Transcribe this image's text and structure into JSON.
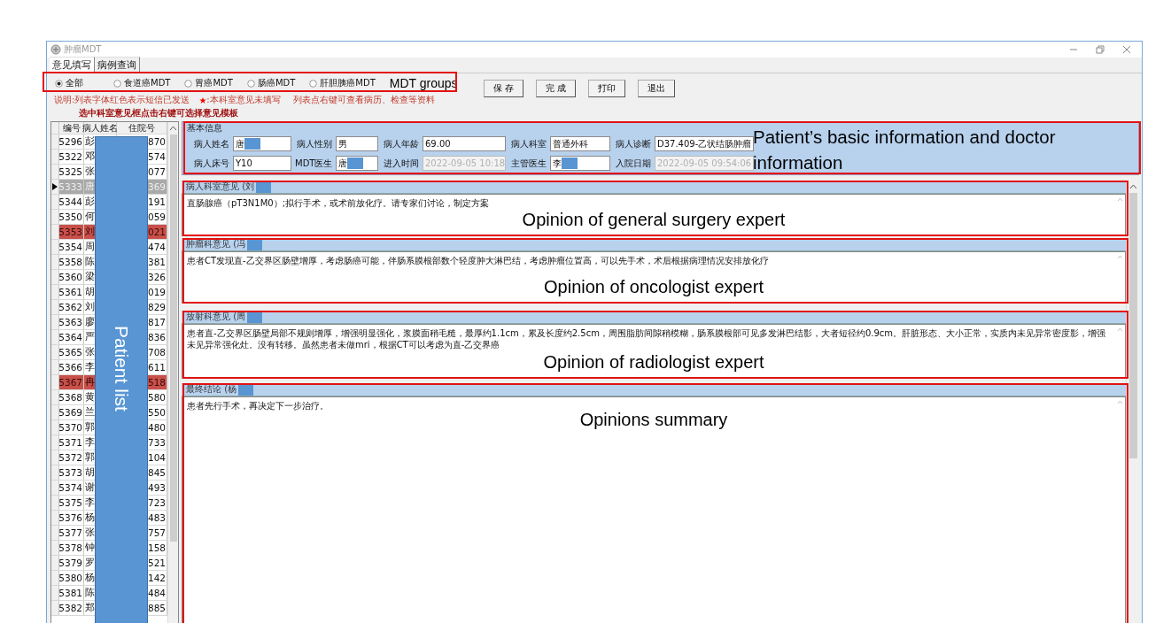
{
  "window": {
    "title": "肿瘤MDT"
  },
  "tabs": [
    {
      "label": "意见填写",
      "selected": true
    },
    {
      "label": "病例查询",
      "selected": false
    }
  ],
  "mdt_groups": {
    "annotation": "MDT groups",
    "options": [
      {
        "label": "全部",
        "selected": true
      },
      {
        "label": "食道癌MDT",
        "selected": false
      },
      {
        "label": "胃癌MDT",
        "selected": false
      },
      {
        "label": "肠癌MDT",
        "selected": false
      },
      {
        "label": "肝胆胰癌MDT",
        "selected": false
      }
    ]
  },
  "notes": {
    "legend": "说明:列表字体红色表示短信已发送",
    "star": "★",
    "star_note": ":本科室意见未填写",
    "context_tip": "列表点右键可查看病历、检查等资料",
    "template_tip": "选中科室意见框点击右键可选择意见模板"
  },
  "buttons": [
    "保 存",
    "完 成",
    "打印",
    "退出"
  ],
  "patient_list": {
    "annotation": "Patient list",
    "columns": [
      "编号",
      "病人姓名",
      "住院号"
    ],
    "rows": [
      {
        "id": "5296",
        "name": "彭",
        "admission_no": "870",
        "selected": false,
        "flagged": false
      },
      {
        "id": "5322",
        "name": "邓",
        "admission_no": "574",
        "selected": false,
        "flagged": false
      },
      {
        "id": "5325",
        "name": "张",
        "admission_no": "077",
        "selected": false,
        "flagged": false
      },
      {
        "id": "5333",
        "name": "唐",
        "admission_no": "369",
        "selected": true,
        "flagged": false
      },
      {
        "id": "5344",
        "name": "彭",
        "admission_no": "191",
        "selected": false,
        "flagged": false
      },
      {
        "id": "5350",
        "name": "何",
        "admission_no": "059",
        "selected": false,
        "flagged": false
      },
      {
        "id": "5353",
        "name": "刘",
        "admission_no": "021",
        "selected": false,
        "flagged": true
      },
      {
        "id": "5354",
        "name": "周",
        "admission_no": "474",
        "selected": false,
        "flagged": false
      },
      {
        "id": "5358",
        "name": "陈",
        "admission_no": "381",
        "selected": false,
        "flagged": false
      },
      {
        "id": "5360",
        "name": "梁",
        "admission_no": "326",
        "selected": false,
        "flagged": false
      },
      {
        "id": "5361",
        "name": "胡",
        "admission_no": "019",
        "selected": false,
        "flagged": false
      },
      {
        "id": "5362",
        "name": "刘",
        "admission_no": "829",
        "selected": false,
        "flagged": false
      },
      {
        "id": "5363",
        "name": "廖",
        "admission_no": "817",
        "selected": false,
        "flagged": false
      },
      {
        "id": "5364",
        "name": "严",
        "admission_no": "836",
        "selected": false,
        "flagged": false
      },
      {
        "id": "5365",
        "name": "张",
        "admission_no": "708",
        "selected": false,
        "flagged": false
      },
      {
        "id": "5366",
        "name": "李",
        "admission_no": "611",
        "selected": false,
        "flagged": false
      },
      {
        "id": "5367",
        "name": "冉",
        "admission_no": "518",
        "selected": false,
        "flagged": true
      },
      {
        "id": "5368",
        "name": "黄",
        "admission_no": "580",
        "selected": false,
        "flagged": false
      },
      {
        "id": "5369",
        "name": "兰",
        "admission_no": "550",
        "selected": false,
        "flagged": false
      },
      {
        "id": "5370",
        "name": "郭",
        "admission_no": "480",
        "selected": false,
        "flagged": false
      },
      {
        "id": "5371",
        "name": "李",
        "admission_no": "733",
        "selected": false,
        "flagged": false
      },
      {
        "id": "5372",
        "name": "郭",
        "admission_no": "104",
        "selected": false,
        "flagged": false
      },
      {
        "id": "5373",
        "name": "胡",
        "admission_no": "845",
        "selected": false,
        "flagged": false
      },
      {
        "id": "5374",
        "name": "谢",
        "admission_no": "493",
        "selected": false,
        "flagged": false
      },
      {
        "id": "5375",
        "name": "李",
        "admission_no": "723",
        "selected": false,
        "flagged": false
      },
      {
        "id": "5376",
        "name": "杨",
        "admission_no": "483",
        "selected": false,
        "flagged": false
      },
      {
        "id": "5377",
        "name": "张",
        "admission_no": "757",
        "selected": false,
        "flagged": false
      },
      {
        "id": "5378",
        "name": "钟",
        "admission_no": "158",
        "selected": false,
        "flagged": false
      },
      {
        "id": "5379",
        "name": "罗",
        "admission_no": "521",
        "selected": false,
        "flagged": false
      },
      {
        "id": "5380",
        "name": "杨",
        "admission_no": "142",
        "selected": false,
        "flagged": false
      },
      {
        "id": "5381",
        "name": "陈",
        "admission_no": "484",
        "selected": false,
        "flagged": false
      },
      {
        "id": "5382",
        "name": "郑",
        "admission_no": "885",
        "selected": false,
        "flagged": false
      }
    ]
  },
  "basic_info": {
    "title": "基本信息",
    "annotation": "Patient’s basic information and doctor information",
    "fields": [
      {
        "label": "病人姓名",
        "value": "唐",
        "redacted": true,
        "kind": "text",
        "disabled": false
      },
      {
        "label": "病人性别",
        "value": "男",
        "redacted": false,
        "kind": "text",
        "disabled": false
      },
      {
        "label": "病人年龄",
        "value": "69.00",
        "redacted": false,
        "kind": "text",
        "disabled": false
      },
      {
        "label": "病人科室",
        "value": "普通外科",
        "redacted": false,
        "kind": "text",
        "disabled": false
      },
      {
        "label": "病人诊断",
        "value": "D37.409-乙状结肠肿瘤",
        "redacted": false,
        "kind": "text",
        "disabled": false
      },
      {
        "label": "病人床号",
        "value": "Y10",
        "redacted": false,
        "kind": "text",
        "disabled": false
      },
      {
        "label": "MDT医生",
        "value": "唐",
        "redacted": true,
        "kind": "text",
        "disabled": false
      },
      {
        "label": "进入时间",
        "value": "2022-09-05  10:18",
        "redacted": false,
        "kind": "dropdown",
        "disabled": true
      },
      {
        "label": "主管医生",
        "value": "李",
        "redacted": true,
        "kind": "text",
        "disabled": false
      },
      {
        "label": "入院日期",
        "value": "2022-09-05  09:54:06",
        "redacted": false,
        "kind": "dropdown",
        "disabled": true
      }
    ]
  },
  "opinions": [
    {
      "title": "病人科室意见 (刘",
      "text": "直肠腺癌（pT3N1M0）;拟行手术，或术前放化疗。请专家们讨论，制定方案",
      "annotation": "Opinion of general surgery expert"
    },
    {
      "title": "肿瘤科意见 (冯",
      "text": "患者CT发现直-乙交界区肠壁增厚，考虑肠癌可能，伴肠系膜根部数个轻度肿大淋巴结，考虑肿瘤位置高，可以先手术，术后根据病理情况安排放化疗",
      "annotation": "Opinion of oncologist expert"
    },
    {
      "title": "放射科意见 (周",
      "text": "患者直-乙交界区肠壁局部不规则增厚，增强明显强化，浆膜面稍毛糙，最厚约1.1cm，累及长度约2.5cm，周围脂肪间隙稍模糊，肠系膜根部可见多发淋巴结影，大者短径约0.9cm。肝脏形态、大小正常，实质内未见异常密度影，增强未见异常强化灶。没有转移。虽然患者未做mri，根据CT可以考虑为直-乙交界癌",
      "annotation": "Opinion of radiologist expert"
    },
    {
      "title": "最终结论 (杨",
      "text": "患者先行手术，再决定下一步治疗。",
      "annotation": "Opinions summary"
    }
  ]
}
